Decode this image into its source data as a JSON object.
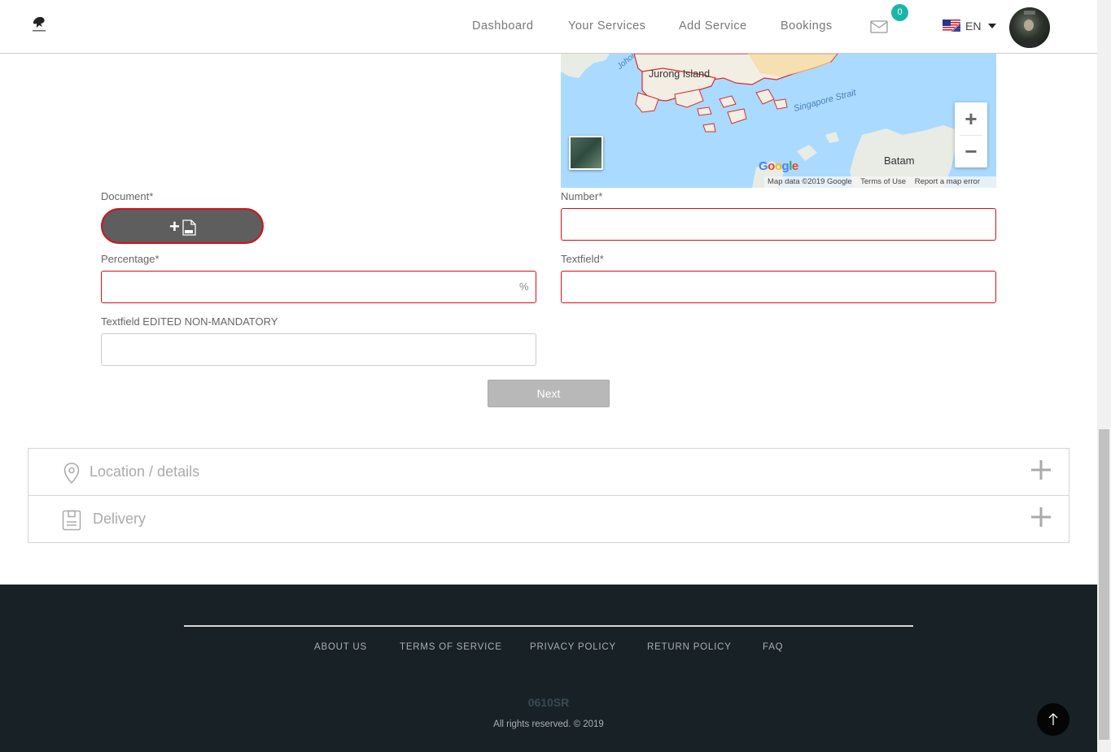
{
  "header": {
    "logo_text": "",
    "nav": [
      "Dashboard",
      "Your Services",
      "Add Service",
      "Bookings"
    ],
    "mail_count": "0",
    "language": "EN"
  },
  "map": {
    "labels": {
      "jurong": "Jurong Island",
      "strait": "Singapore Strait",
      "batam": "Batam",
      "johor": "Johor"
    },
    "google_logo": "Google",
    "footer": {
      "data": "Map data ©2019 Google",
      "terms": "Terms of Use",
      "report": "Report a map error"
    },
    "zoom_in": "+",
    "zoom_out": "−"
  },
  "form": {
    "document_label": "Document*",
    "number_label": "Number*",
    "number_value": "",
    "percentage_label": "Percentage*",
    "percentage_value": "",
    "percentage_suffix": "%",
    "textfield_label": "Textfield*",
    "textfield_value": "",
    "textfield_optional_label": "Textfield EDITED NON-MANDATORY",
    "textfield_optional_value": "",
    "next_label": "Next"
  },
  "accordion": [
    {
      "title": "Location / details",
      "icon": "location-pin-icon"
    },
    {
      "title": "Delivery",
      "icon": "delivery-box-icon"
    }
  ],
  "footer": {
    "links": [
      "ABOUT US",
      "TERMS OF SERVICE",
      "PRIVACY POLICY",
      "RETURN POLICY",
      "FAQ"
    ],
    "brand": "0610SR",
    "copyright": "All rights reserved. © 2019"
  },
  "colors": {
    "error_border": "#d60f19",
    "badge": "#17b6a8",
    "footer_bg": "#172126",
    "map_water": "#aadaff"
  }
}
